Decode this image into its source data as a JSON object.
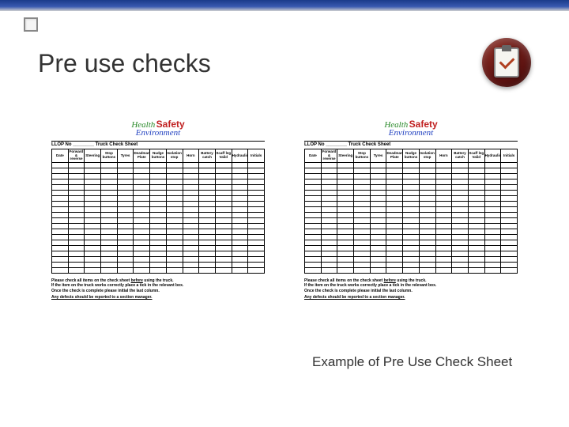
{
  "title": "Pre use checks",
  "caption": "Example of Pre Use Check Sheet",
  "sheet": {
    "logo": {
      "health": "Health",
      "safety": "Safety",
      "environment": "Environment"
    },
    "heading_prefix": "LLOP No",
    "heading_suffix": "Truck Check Sheet",
    "columns": [
      "Date",
      "Forward & reverse",
      "Steering",
      "Stop buttons",
      "Tyres",
      "Deadman Plate",
      "Nudge buttons",
      "Isolation stop",
      "Horn",
      "Battery catch",
      "Scaff leg Valid",
      "Hydraulics",
      "Initials"
    ],
    "row_count": 20,
    "footer_lines": [
      "Please check all items on the check sheet before using the truck.",
      "If the item on the truck works correctly place a tick in the relevant box.",
      "Once the check is complete please initial the last column."
    ],
    "footer_report": "Any defects should be reported to a section manager."
  }
}
